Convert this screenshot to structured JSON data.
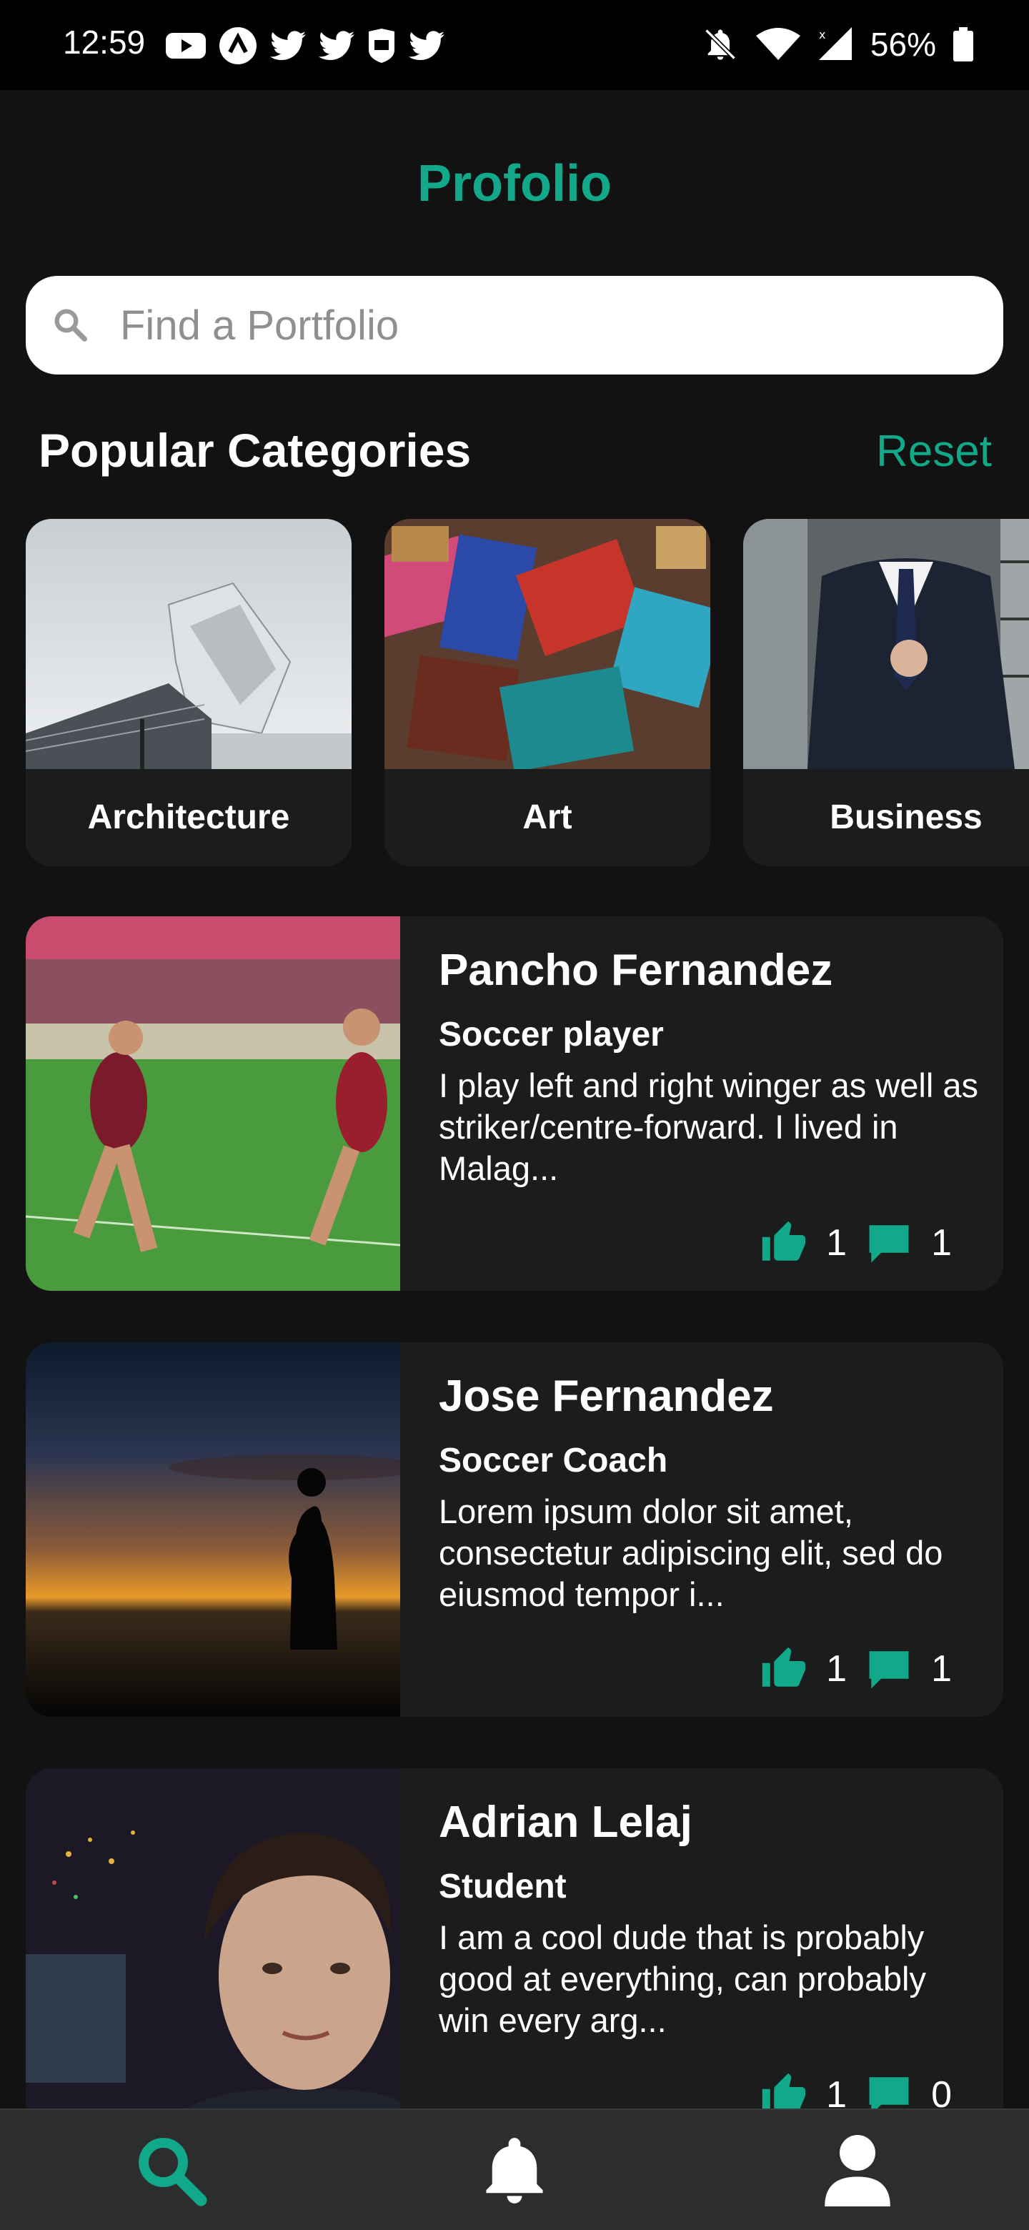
{
  "status_bar": {
    "time": "12:59",
    "battery": "56%",
    "left_icons": [
      "youtube-icon",
      "app-icon",
      "twitter-icon",
      "twitter-icon",
      "nfl-icon",
      "twitter-icon"
    ],
    "right_icons": [
      "notifications-off-icon",
      "wifi-icon",
      "signal-icon",
      "battery-icon"
    ]
  },
  "header": {
    "title": "Profolio"
  },
  "search": {
    "placeholder": "Find a Portfolio"
  },
  "categories_section": {
    "title": "Popular Categories",
    "reset_label": "Reset",
    "items": [
      {
        "label": "Architecture"
      },
      {
        "label": "Art"
      },
      {
        "label": "Business"
      }
    ]
  },
  "portfolios": [
    {
      "name": "Pancho Fernandez",
      "role": "Soccer player",
      "description": "I play left and right winger as well as striker/centre-forward. I lived in Malag...",
      "likes": "1",
      "comments": "1"
    },
    {
      "name": "Jose Fernandez",
      "role": "Soccer Coach",
      "description": "Lorem ipsum dolor sit amet, consectetur adipiscing elit, sed do eiusmod tempor i...",
      "likes": "1",
      "comments": "1"
    },
    {
      "name": "Adrian Lelaj",
      "role": "Student",
      "description": "I am a cool dude that is probably good at everything, can probably win every arg...",
      "likes": "1",
      "comments": "0"
    }
  ],
  "bottom_nav": {
    "items": [
      "search-icon",
      "bell-icon",
      "profile-icon"
    ],
    "active": "search-icon"
  },
  "colors": {
    "accent": "#12a88a",
    "background": "#121212",
    "card": "#1b1d1c",
    "nav": "#2c2e2d"
  }
}
